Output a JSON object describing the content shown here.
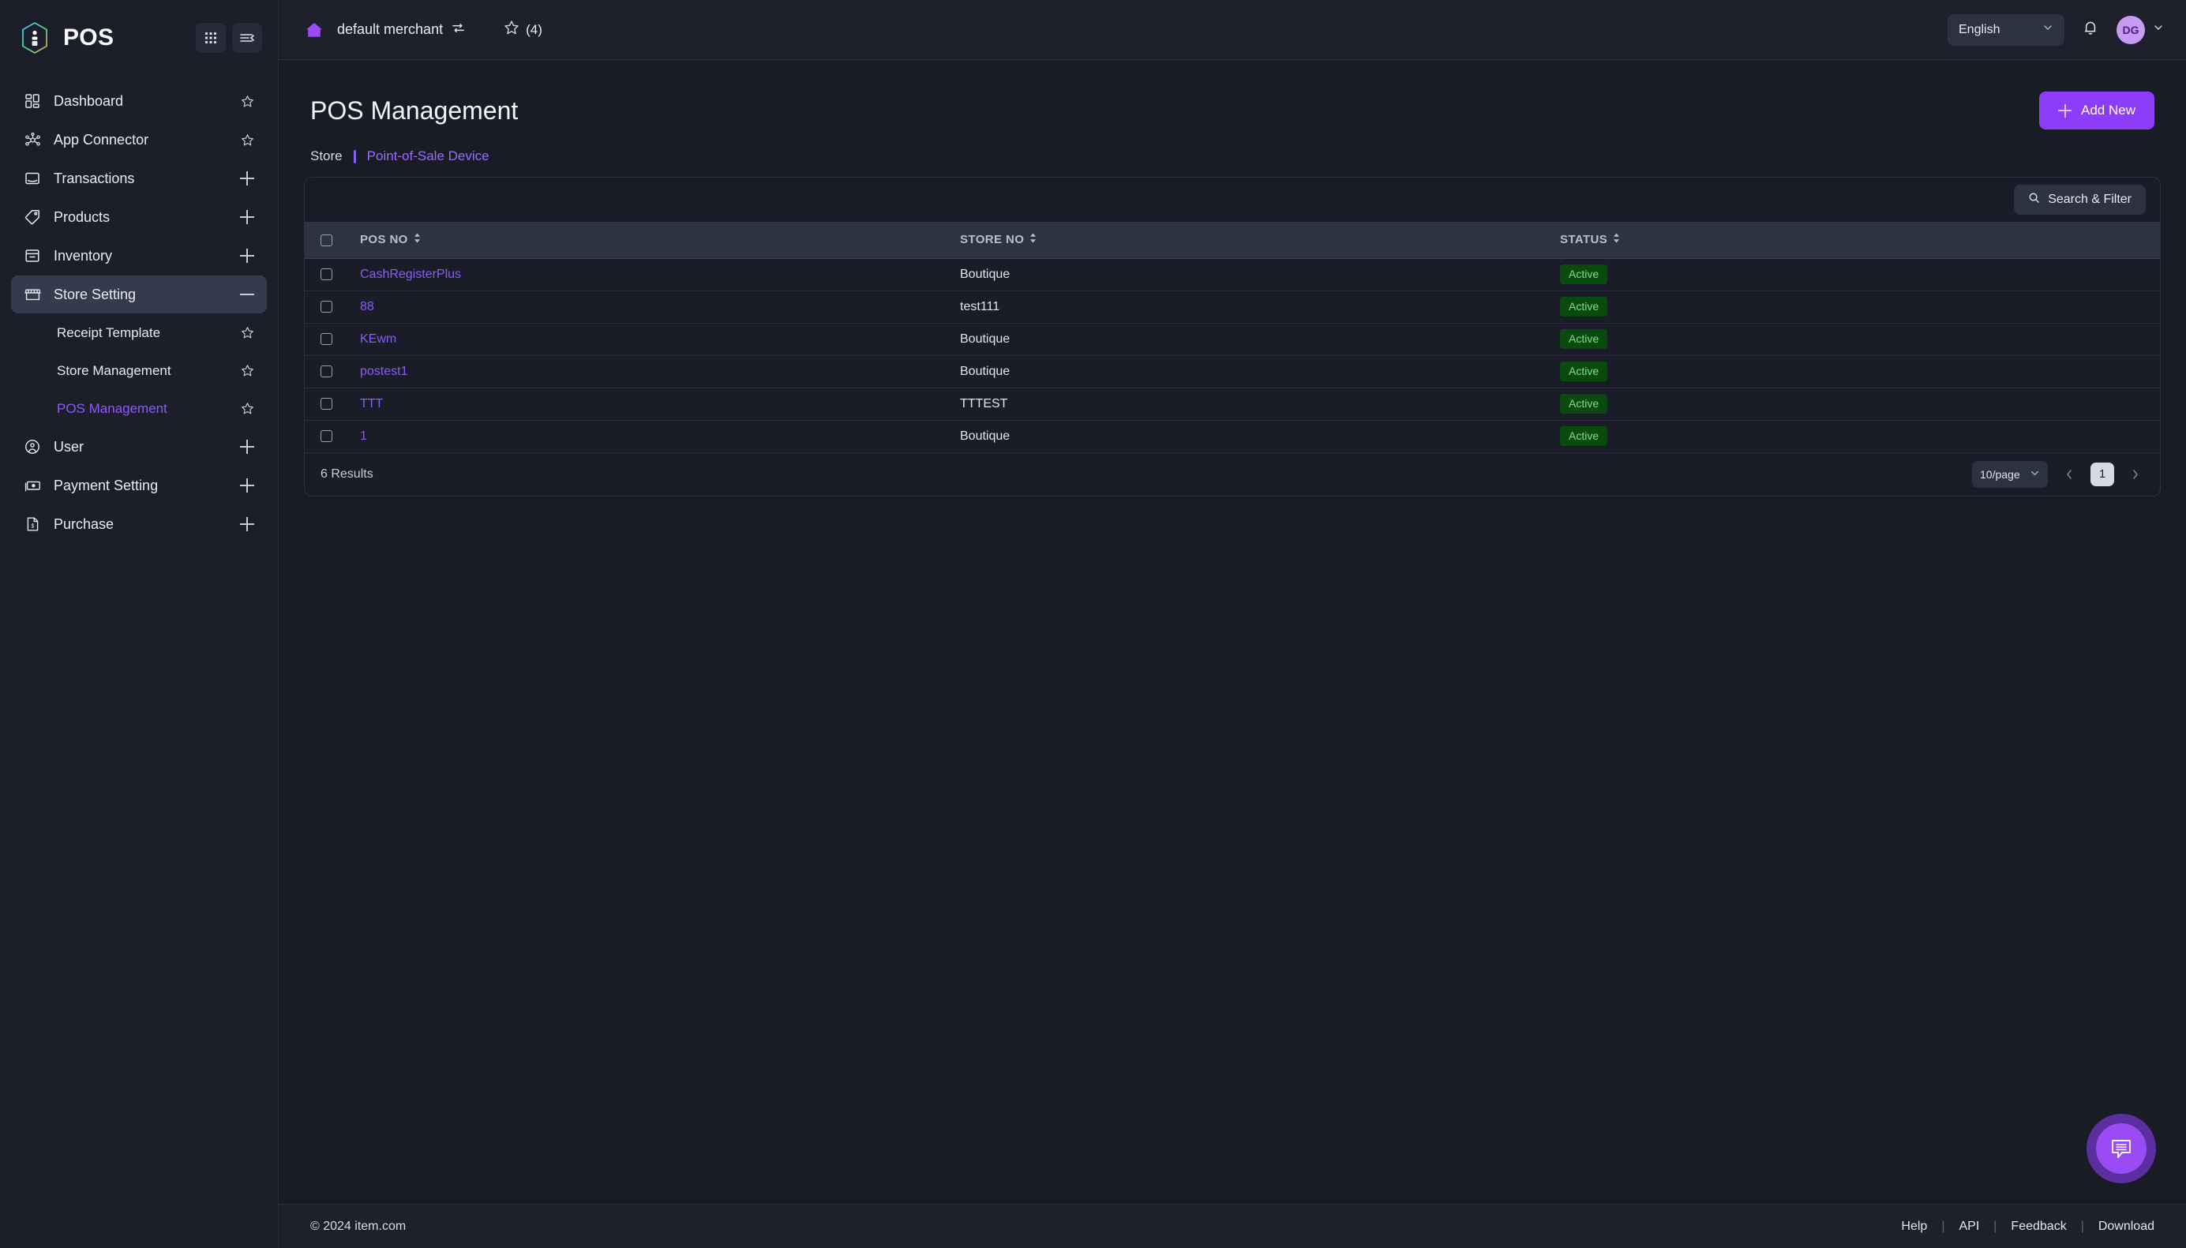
{
  "brand": {
    "name": "POS",
    "logo_icon": "hexagon-logo-icon"
  },
  "sidebar": {
    "top_actions": [
      {
        "name": "apps-grid-icon",
        "label": ""
      },
      {
        "name": "collapse-sidebar-icon",
        "label": ""
      }
    ],
    "items": [
      {
        "label": "Dashboard",
        "icon": "dashboard-icon",
        "right": "star",
        "level": 0,
        "state": ""
      },
      {
        "label": "App Connector",
        "icon": "app-connector-icon",
        "right": "star",
        "level": 0,
        "state": ""
      },
      {
        "label": "Transactions",
        "icon": "transactions-icon",
        "right": "plus",
        "level": 0,
        "state": ""
      },
      {
        "label": "Products",
        "icon": "products-tag-icon",
        "right": "plus",
        "level": 0,
        "state": ""
      },
      {
        "label": "Inventory",
        "icon": "inventory-box-icon",
        "right": "plus",
        "level": 0,
        "state": ""
      },
      {
        "label": "Store Setting",
        "icon": "store-icon",
        "right": "minus",
        "level": 0,
        "state": "active"
      },
      {
        "label": "Receipt Template",
        "icon": "",
        "right": "star",
        "level": 1,
        "state": ""
      },
      {
        "label": "Store Management",
        "icon": "",
        "right": "star",
        "level": 1,
        "state": ""
      },
      {
        "label": "POS Management",
        "icon": "",
        "right": "star",
        "level": 1,
        "state": "current"
      },
      {
        "label": "User",
        "icon": "user-circle-icon",
        "right": "plus",
        "level": 0,
        "state": ""
      },
      {
        "label": "Payment Setting",
        "icon": "payment-cash-icon",
        "right": "plus",
        "level": 0,
        "state": ""
      },
      {
        "label": "Purchase",
        "icon": "purchase-doc-icon",
        "right": "plus",
        "level": 0,
        "state": ""
      }
    ]
  },
  "topbar": {
    "home_icon": "home-icon",
    "merchant": "default merchant",
    "switch_icon": "switch-merchant-icon",
    "favorites_icon": "star-outline-icon",
    "favorites_count": "(4)",
    "language": "English",
    "notification_icon": "bell-icon",
    "avatar_initials": "DG"
  },
  "page": {
    "title": "POS Management",
    "add_button": "Add New",
    "breadcrumb": {
      "parent": "Store",
      "current": "Point-of-Sale Device"
    }
  },
  "toolbar": {
    "search_filter": "Search & Filter",
    "search_icon": "search-icon"
  },
  "table": {
    "columns": [
      "POS NO",
      "STORE NO",
      "STATUS"
    ],
    "rows": [
      {
        "pos_no": "CashRegisterPlus",
        "store_no": "Boutique",
        "status": "Active"
      },
      {
        "pos_no": "88",
        "store_no": "test111",
        "status": "Active"
      },
      {
        "pos_no": "KEwm",
        "store_no": "Boutique",
        "status": "Active"
      },
      {
        "pos_no": "postest1",
        "store_no": "Boutique",
        "status": "Active"
      },
      {
        "pos_no": "TTT",
        "store_no": "TTTEST",
        "status": "Active"
      },
      {
        "pos_no": "1",
        "store_no": "Boutique",
        "status": "Active"
      }
    ]
  },
  "pagination": {
    "results": "6 Results",
    "per_page": "10/page",
    "current_page": "1",
    "prev_icon": "chevron-left-icon",
    "next_icon": "chevron-right-icon"
  },
  "footer": {
    "copyright": "© 2024 item.com",
    "links": [
      "Help",
      "API",
      "Feedback",
      "Download"
    ],
    "separator": "|"
  },
  "fab": {
    "icon": "chat-bubble-icon"
  },
  "colors": {
    "accent": "#8b5cf6",
    "accent_button": "#8b3dfa",
    "status_active_bg": "#0a4a0f",
    "status_active_text": "#7ee08a",
    "sidebar_bg": "#1c1f2a",
    "panel_bg": "#1a1d27",
    "table_header_bg": "#2d3343"
  }
}
